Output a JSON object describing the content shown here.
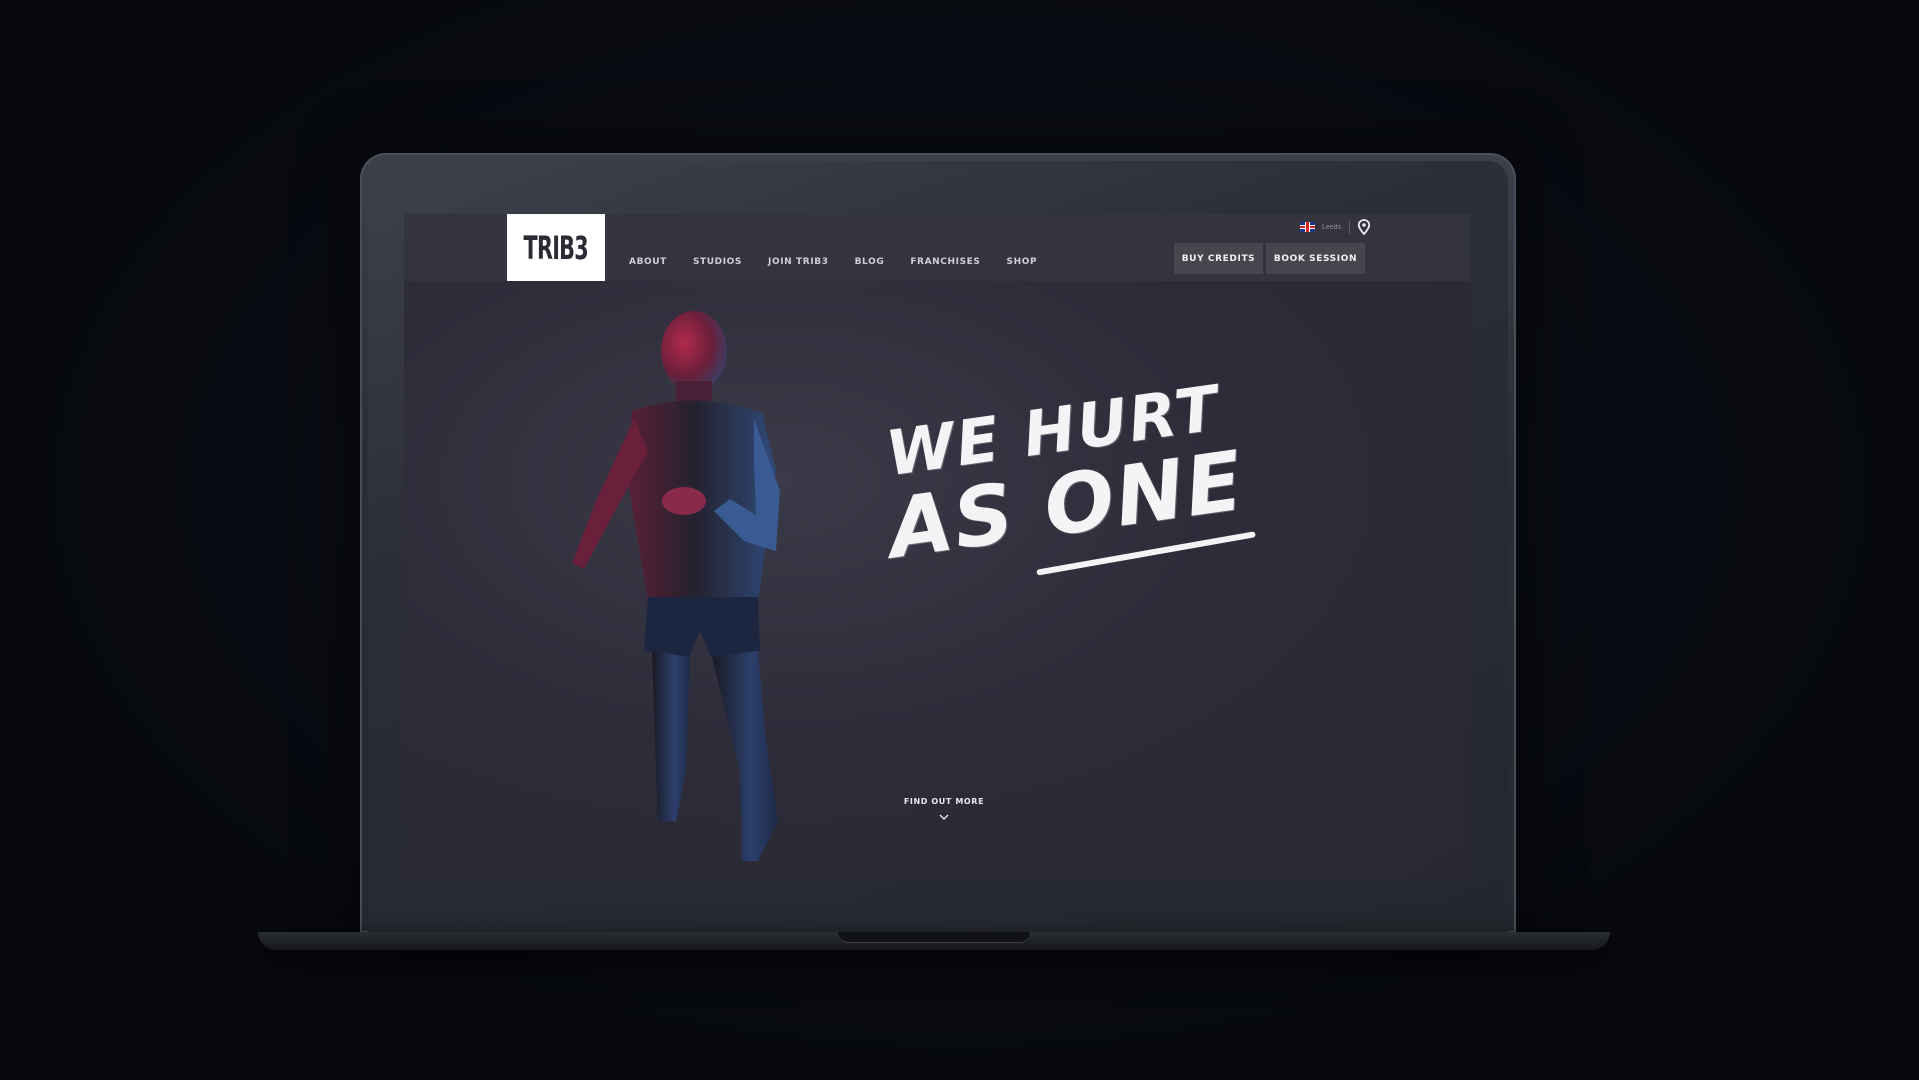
{
  "site": {
    "logo": "TRIB3",
    "nav": [
      {
        "label": "ABOUT"
      },
      {
        "label": "STUDIOS"
      },
      {
        "label": "JOIN TRIB3"
      },
      {
        "label": "BLOG"
      },
      {
        "label": "FRANCHISES"
      },
      {
        "label": "SHOP"
      }
    ],
    "locale": {
      "flag_icon": "uk-flag-icon",
      "label": "Leeds",
      "location_icon": "map-pin-icon"
    },
    "actions": {
      "buy_credits": "BUY CREDITS",
      "book_session": "BOOK SESSION"
    }
  },
  "hero": {
    "headline_line_1": "WE HURT",
    "headline_line_2": "AS ONE",
    "cta_label": "FIND OUT MORE",
    "cta_icon": "chevron-down-icon"
  },
  "colors": {
    "background": "#080b12",
    "header": "#34343f",
    "button": "#46464f",
    "text": "#f4f4f6"
  }
}
